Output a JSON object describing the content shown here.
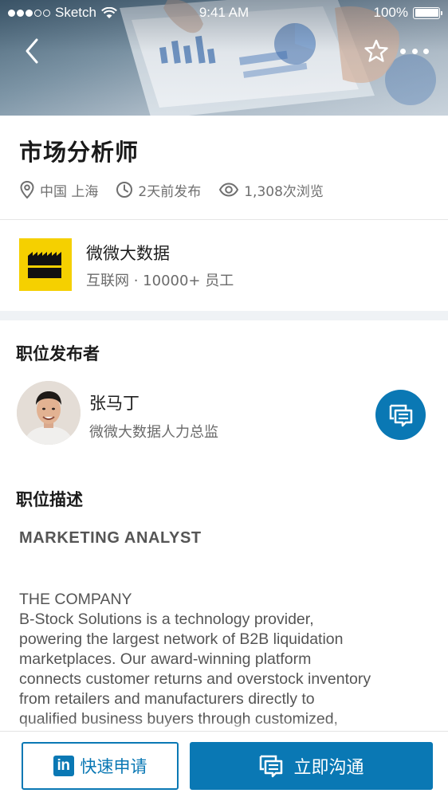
{
  "status_bar": {
    "carrier": "Sketch",
    "time": "9:41 AM",
    "battery": "100%",
    "signal_dots_filled": 3,
    "signal_dots_total": 5
  },
  "nav": {
    "back_icon": "chevron-left-icon",
    "favorite_icon": "star-outline-icon",
    "more_icon": "more-dots-icon"
  },
  "job": {
    "title": "市场分析师",
    "location": "中国 上海",
    "posted": "2天前发布",
    "views": "1,308次浏览"
  },
  "company": {
    "name": "微微大数据",
    "info": "互联网 · 10000+ 员工",
    "logo_color": "#f5d000"
  },
  "poster": {
    "section_title": "职位发布者",
    "name": "张马丁",
    "role": "微微大数据人力总监",
    "message_icon": "message-icon"
  },
  "description": {
    "section_title": "职位描述",
    "heading": "MARKETING ANALYST",
    "lines": [
      "THE COMPANY",
      "B-Stock Solutions is a technology provider,",
      "powering the largest network of B2B liquidation",
      "marketplaces. Our award-winning platform",
      "connects customer returns and overstock inventory",
      "from retailers and manufacturers directly to",
      "qualified business buyers through customized,"
    ]
  },
  "actions": {
    "apply_label": "快速申请",
    "apply_logo": "in",
    "chat_label": "立即沟通"
  },
  "colors": {
    "accent": "#0a78b4",
    "text_primary": "#1e1e1e",
    "text_secondary": "#6b6b6b",
    "band": "#eff2f5"
  }
}
